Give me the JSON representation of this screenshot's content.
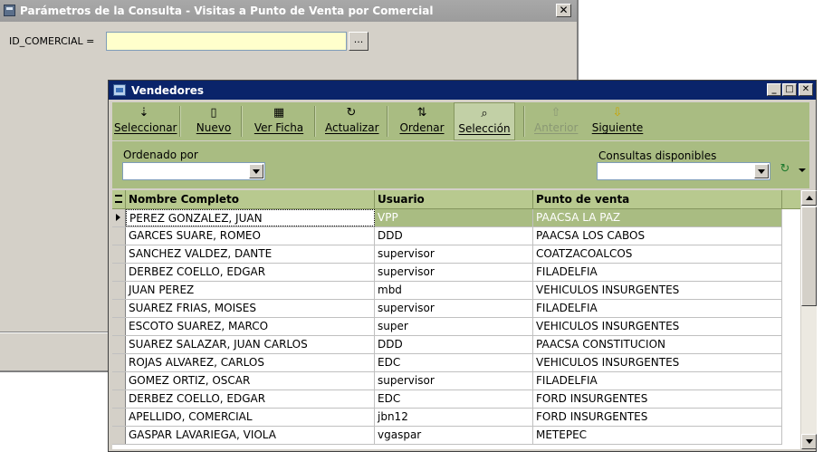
{
  "params_dialog": {
    "title": "Parámetros de la Consulta - Visitas a Punto de Venta por Comercial",
    "close_glyph": "✕",
    "param_label": "ID_COMERCIAL =",
    "param_value": "",
    "browse_label": "..."
  },
  "vendedores_window": {
    "title": "Vendedores",
    "toolbar": [
      {
        "label": "Seleccionar",
        "icon": "select-icon",
        "glyph": "⇣",
        "enabled": true
      },
      {
        "label": "Nuevo",
        "icon": "new-document-icon",
        "glyph": "▯",
        "enabled": true
      },
      {
        "label": "Ver Ficha",
        "icon": "view-card-icon",
        "glyph": "▦",
        "enabled": true
      },
      {
        "label": "Actualizar",
        "icon": "refresh-icon",
        "glyph": "↻",
        "enabled": true
      },
      {
        "label": "Ordenar",
        "icon": "sort-icon",
        "glyph": "⇅",
        "enabled": true
      },
      {
        "label": "Selección",
        "icon": "magnifier-icon",
        "glyph": "⌕",
        "enabled": true,
        "selected": true
      },
      {
        "label": "Anterior",
        "icon": "arrow-up-icon",
        "glyph": "⇧",
        "enabled": false
      },
      {
        "label": "Siguiente",
        "icon": "arrow-down-icon",
        "glyph": "⇩",
        "enabled": true
      }
    ],
    "filters": {
      "ordenado_label": "Ordenado por",
      "ordenado_value": "",
      "consultas_label": "Consultas disponibles",
      "consultas_value": ""
    },
    "grid": {
      "columns": [
        "Nombre Completo",
        "Usuario",
        "Punto de venta"
      ],
      "rows": [
        [
          "PEREZ GONZALEZ, JUAN",
          "VPP",
          "PAACSA LA PAZ"
        ],
        [
          "GARCES SUARE, ROMEO",
          "DDD",
          "PAACSA LOS CABOS"
        ],
        [
          "SANCHEZ VALDEZ, DANTE",
          "supervisor",
          "COATZACOALCOS"
        ],
        [
          "DERBEZ COELLO, EDGAR",
          "supervisor",
          "FILADELFIA"
        ],
        [
          "JUAN PEREZ",
          "mbd",
          "VEHICULOS INSURGENTES"
        ],
        [
          "SUAREZ FRIAS, MOISES",
          "supervisor",
          "FILADELFIA"
        ],
        [
          "ESCOTO SUAREZ, MARCO",
          "super",
          "VEHICULOS INSURGENTES"
        ],
        [
          "SUAREZ SALAZAR, JUAN CARLOS",
          "DDD",
          "PAACSA CONSTITUCION"
        ],
        [
          "ROJAS ALVAREZ, CARLOS",
          "EDC",
          "VEHICULOS INSURGENTES"
        ],
        [
          "GOMEZ ORTIZ, OSCAR",
          "supervisor",
          "FILADELFIA"
        ],
        [
          "DERBEZ COELLO, EDGAR",
          "EDC",
          "FORD INSURGENTES"
        ],
        [
          "APELLIDO, COMERCIAL",
          "jbn12",
          "FORD INSURGENTES"
        ],
        [
          "GASPAR LAVARIEGA, VIOLA",
          "vgaspar",
          "METEPEC"
        ]
      ]
    }
  }
}
